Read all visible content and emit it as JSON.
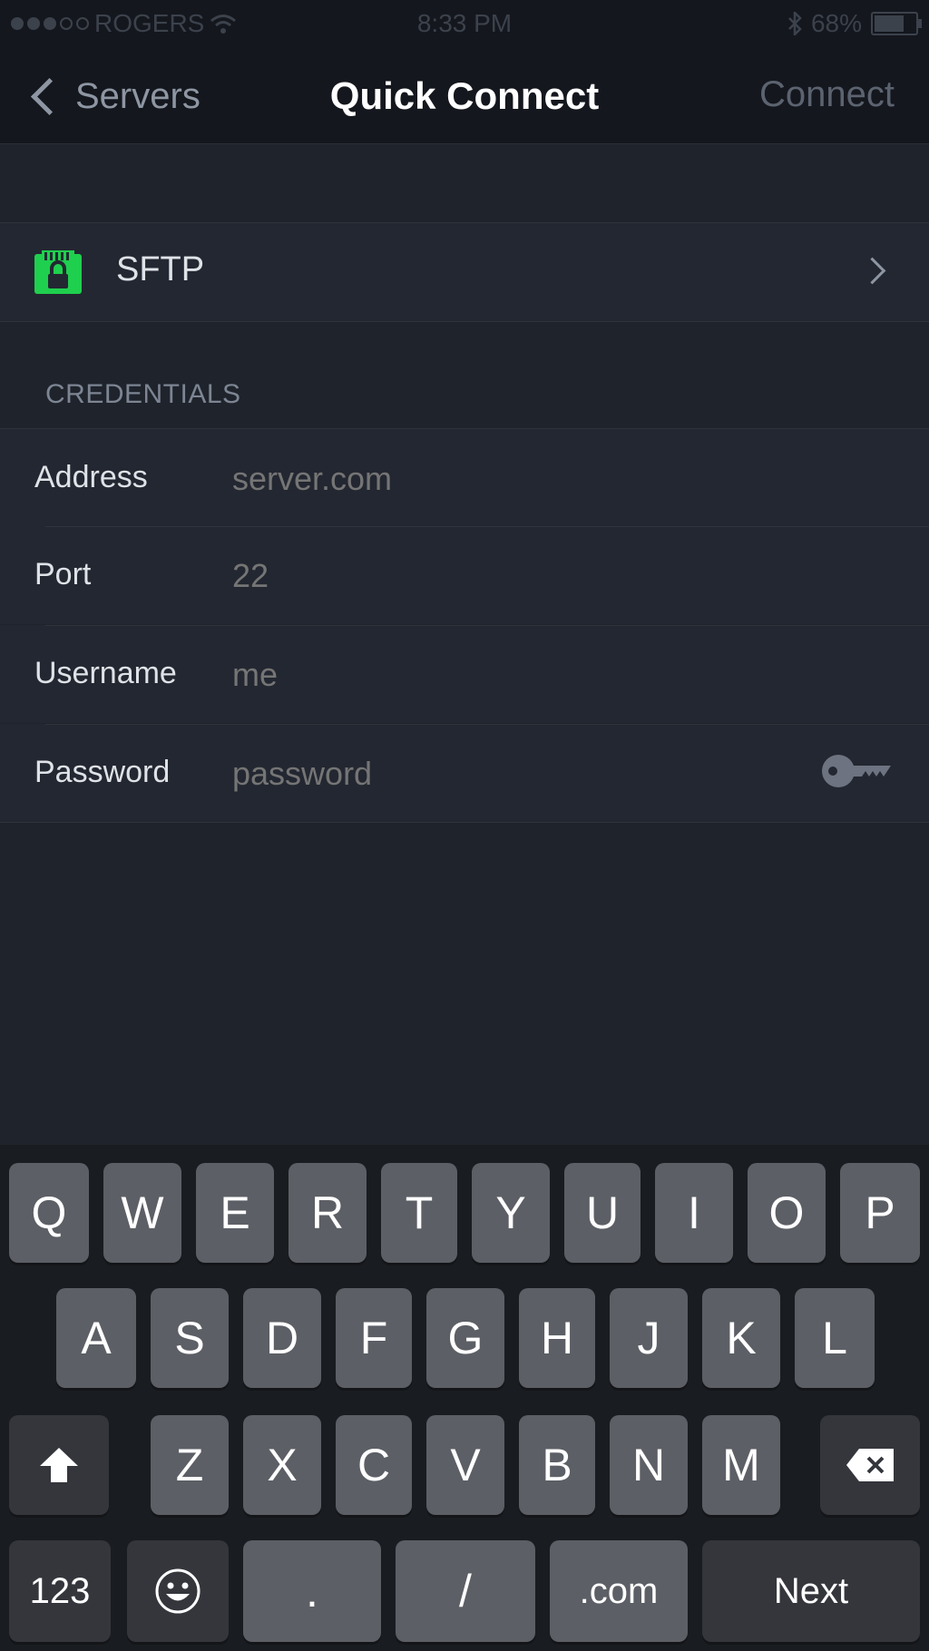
{
  "status": {
    "carrier": "ROGERS",
    "time": "8:33 PM",
    "battery": "68%"
  },
  "nav": {
    "back_label": "Servers",
    "title": "Quick Connect",
    "action_label": "Connect"
  },
  "protocol": {
    "label": "SFTP",
    "icon": "sftp-lock-icon",
    "icon_color": "#1fcf4e"
  },
  "credentials": {
    "section_title": "CREDENTIALS",
    "fields": [
      {
        "label": "Address",
        "placeholder": "server.com"
      },
      {
        "label": "Port",
        "placeholder": "22"
      },
      {
        "label": "Username",
        "placeholder": "me"
      },
      {
        "label": "Password",
        "placeholder": "password"
      }
    ]
  },
  "keyboard": {
    "row1": [
      "Q",
      "W",
      "E",
      "R",
      "T",
      "Y",
      "U",
      "I",
      "O",
      "P"
    ],
    "row2": [
      "A",
      "S",
      "D",
      "F",
      "G",
      "H",
      "J",
      "K",
      "L"
    ],
    "row3": [
      "Z",
      "X",
      "C",
      "V",
      "B",
      "N",
      "M"
    ],
    "numbers_key": "123",
    "period_key": ".",
    "slash_key": "/",
    "dotcom_key": ".com",
    "next_key": "Next"
  }
}
